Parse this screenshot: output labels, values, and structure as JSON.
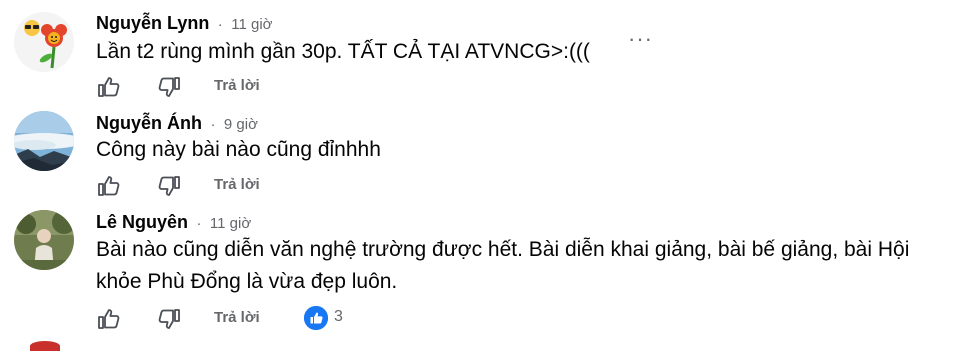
{
  "comments": [
    {
      "name": "Nguyễn Lynn",
      "separator": "·",
      "time": "11 giờ",
      "text": "Lần t2 rùng mình gần 30p. TẤT CẢ TẠI ATVNCG>:(((",
      "more": "···",
      "reply": "Trả lời",
      "avatar": "flower-emoji-avatar"
    },
    {
      "name": "Nguyễn Ánh",
      "separator": "·",
      "time": "9 giờ",
      "text": "Công này bài nào cũng đỉnhhh",
      "reply": "Trả lời",
      "avatar": "landscape-sea-of-clouds-avatar"
    },
    {
      "name": "Lê Nguyên",
      "separator": "·",
      "time": "11 giờ",
      "text": "Bài nào cũng diễn văn nghệ trường được hết. Bài diễn khai giảng, bài bế giảng, bài Hội khỏe Phù Đổng là vừa đẹp luôn.",
      "reply": "Trả lời",
      "reaction": {
        "icon": "like-icon",
        "count": "3",
        "color": "#1877f2"
      },
      "avatar": "person-outdoor-avatar"
    }
  ],
  "colors": {
    "secondary": "#65676b",
    "primary_text": "#050505",
    "like_blue": "#1877f2"
  }
}
